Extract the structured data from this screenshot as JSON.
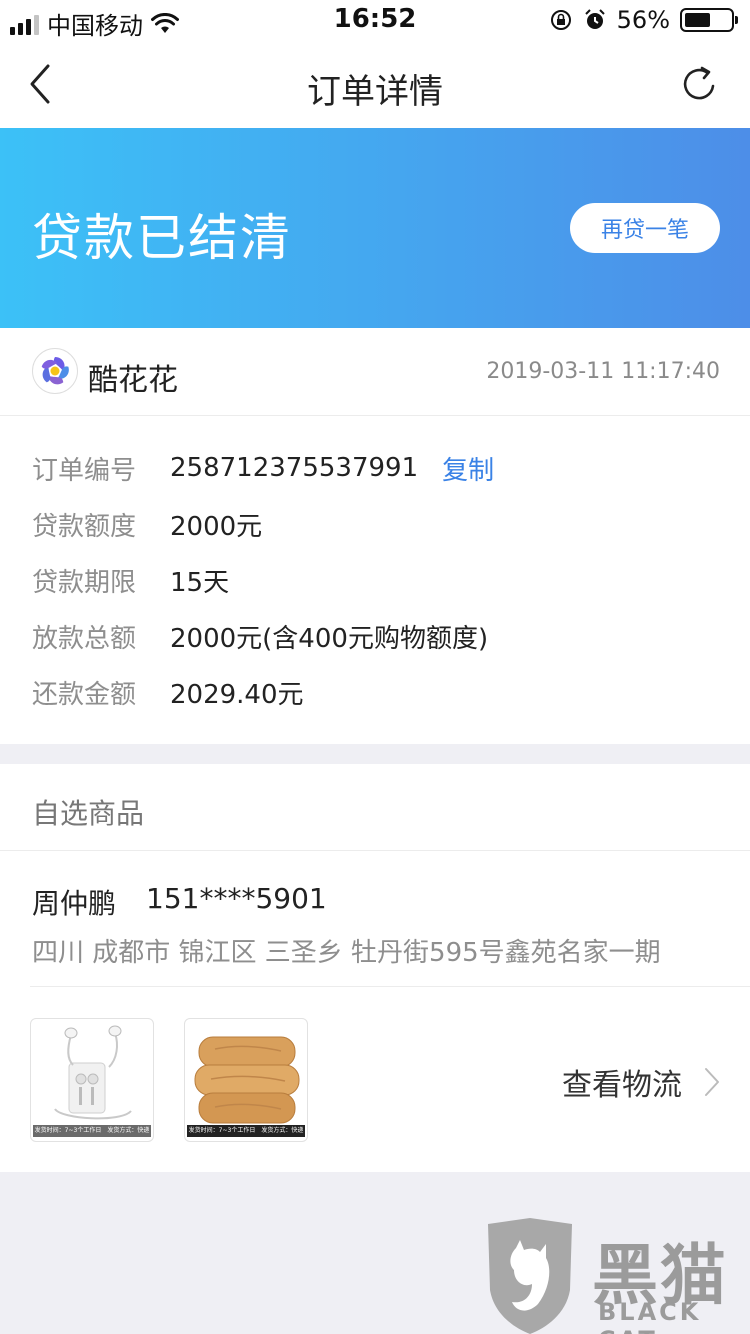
{
  "status_bar": {
    "carrier": "中国移动",
    "time": "16:52",
    "battery_text": "56%",
    "battery_level": 0.56
  },
  "nav": {
    "title": "订单详情"
  },
  "banner": {
    "status": "贷款已结清",
    "action_label": "再贷一笔"
  },
  "merchant": {
    "name": "酷花花",
    "time": "2019-03-11 11:17:40"
  },
  "order_info": [
    {
      "label": "订单编号",
      "value": "258712375537991"
    },
    {
      "label": "贷款额度",
      "value": "2000元"
    },
    {
      "label": "贷款期限",
      "value": "15天"
    },
    {
      "label": "放款总额",
      "value": "2000元(含400元购物额度)"
    },
    {
      "label": "还款金额",
      "value": "2029.40元"
    }
  ],
  "copy_label": "复制",
  "goods": {
    "title": "自选商品",
    "recipient_name": "周仲鹏",
    "recipient_phone": "151****5901",
    "address": "四川 成都市 锦江区 三圣乡 牡丹街595号鑫苑名家一期",
    "items": [
      {
        "icon": "earphones-product-image",
        "caption": "发货时间：7~3个工作日　发货方式：快递"
      },
      {
        "icon": "quilt-product-image",
        "caption": "发货时间：7~3个工作日　发货方式：快递"
      }
    ],
    "logistics_label": "查看物流"
  },
  "watermark": {
    "cn": "黑猫",
    "en": "BLACK CAT"
  },
  "colors": {
    "banner_start": "#3cc1f7",
    "banner_end": "#4d8ee8",
    "link": "#3a82e6",
    "page_bg": "#efeff4"
  }
}
